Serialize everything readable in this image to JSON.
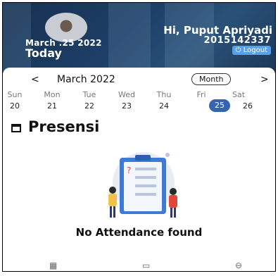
{
  "header": {
    "greeting": "Hi, Puput Apriyadi",
    "student_id": "2015142337",
    "logout_label": "⏻ Logout",
    "date_label": "March .25 2022",
    "today_label": "Today"
  },
  "calendar": {
    "prev_label": "<",
    "next_label": ">",
    "month_year": "March 2022",
    "view_mode": "Month",
    "days": [
      {
        "dow": "Sun",
        "num": "20"
      },
      {
        "dow": "Mon",
        "num": "21"
      },
      {
        "dow": "Tue",
        "num": "22"
      },
      {
        "dow": "Wed",
        "num": "23"
      },
      {
        "dow": "Thu",
        "num": "24"
      },
      {
        "dow": "Fri",
        "num": "25"
      },
      {
        "dow": "Sat",
        "num": "26"
      }
    ],
    "selected_day": "25"
  },
  "section": {
    "title": "Presensi",
    "empty_message": "No Attendance found"
  },
  "bottom_nav": {
    "items": [
      {
        "icon": "grid-icon",
        "glyph": "▦"
      },
      {
        "icon": "calendar-icon",
        "glyph": "▭"
      },
      {
        "icon": "profile-icon",
        "glyph": "⊖"
      }
    ]
  },
  "colors": {
    "header_dark": "#16304f",
    "selected_day": "#3565b0",
    "logout_button": "#5aa0e6"
  }
}
